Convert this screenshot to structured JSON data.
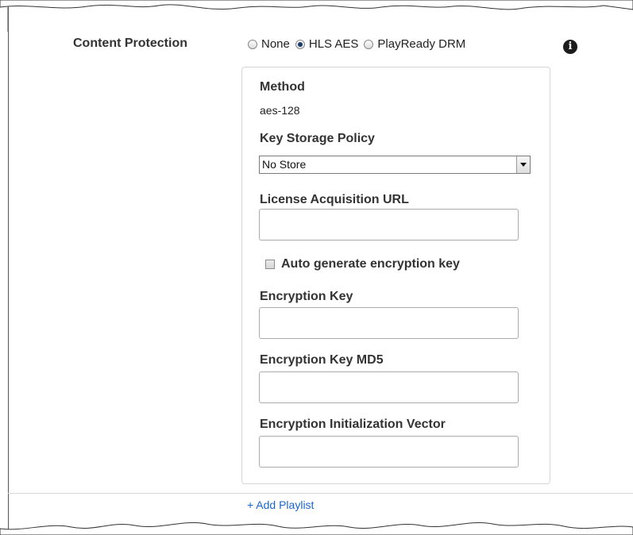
{
  "content_protection": {
    "label": "Content Protection",
    "options": [
      {
        "label": "None",
        "checked": false
      },
      {
        "label": "HLS AES",
        "checked": true
      },
      {
        "label": "PlayReady DRM",
        "checked": false
      }
    ],
    "info_icon": "info-icon",
    "info_glyph": "i"
  },
  "panel": {
    "method_label": "Method",
    "method_value": "aes-128",
    "key_storage_label": "Key Storage Policy",
    "key_storage_value": "No Store",
    "license_url_label": "License Acquisition URL",
    "license_url_value": "",
    "auto_generate_label": "Auto generate encryption key",
    "auto_generate_checked": false,
    "encryption_key_label": "Encryption Key",
    "encryption_key_value": "",
    "encryption_key_md5_label": "Encryption Key MD5",
    "encryption_key_md5_value": "",
    "init_vector_label": "Encryption Initialization Vector",
    "init_vector_value": ""
  },
  "add_playlist_label": "+ Add Playlist"
}
